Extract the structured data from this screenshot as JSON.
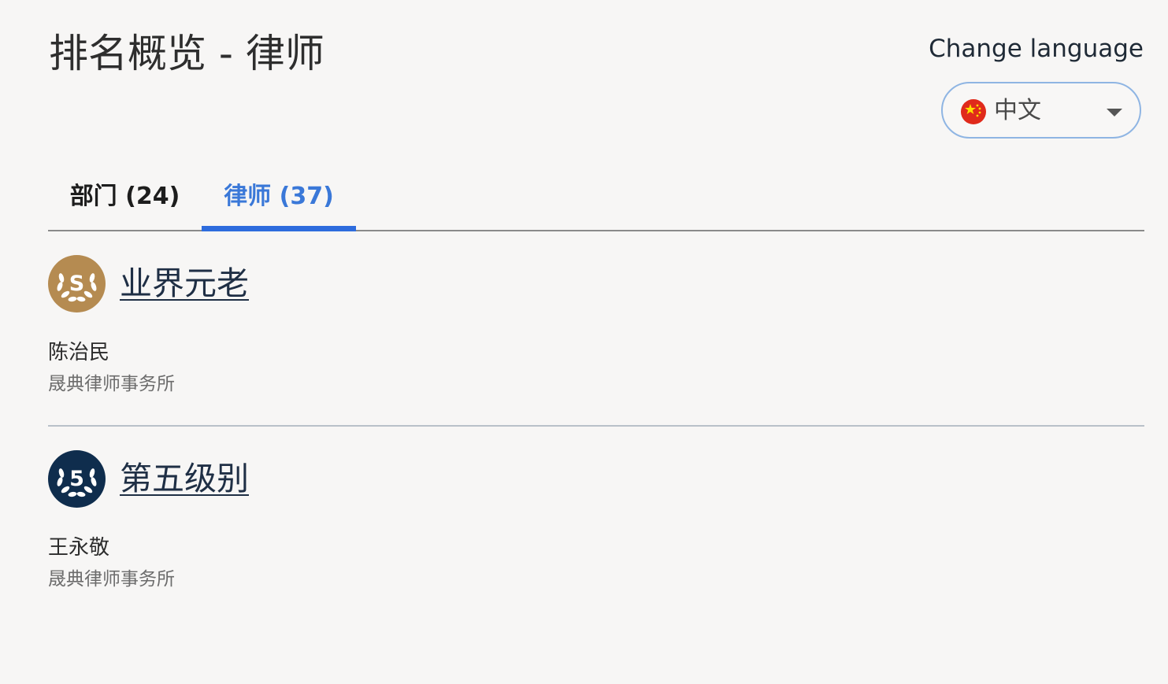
{
  "page": {
    "title": "排名概览 - 律师"
  },
  "language": {
    "label": "Change language",
    "selected": "中文",
    "flag_icon": "china-flag-icon"
  },
  "tabs": [
    {
      "label": "部门 (24)",
      "active": false
    },
    {
      "label": "律师 (37)",
      "active": true
    }
  ],
  "rankings": [
    {
      "band": "业界元老",
      "badge_icon": "senior-statespeople-laurel-icon",
      "badge_text": "S",
      "badge_color": "#b58b51",
      "person": "陈治民",
      "firm": "晟典律师事务所"
    },
    {
      "band": "第五级别",
      "badge_icon": "band-5-laurel-icon",
      "badge_text": "5",
      "badge_color": "#0f2d4d",
      "person": "王永敬",
      "firm": "晟典律师事务所"
    }
  ],
  "colors": {
    "active_tab": "#2e6cdd",
    "select_border": "#8fb5e3"
  }
}
